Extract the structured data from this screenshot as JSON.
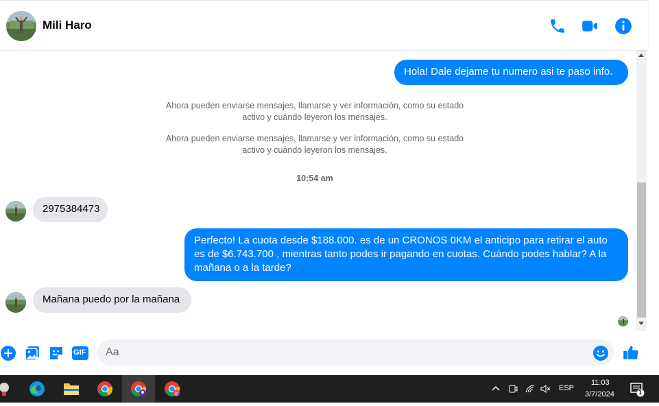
{
  "conversation": {
    "contact_name": "Mili Haro"
  },
  "messages": {
    "m1": "Hola! Dale dejame tu numero  asi te paso info.",
    "sys1_line1": "Ahora pueden enviarse mensajes, llamarse y ver información, como su estado",
    "sys1_line2": "activo y cuándo leyeron los mensajes.",
    "sys2_line1": "Ahora pueden enviarse mensajes, llamarse y ver información, como su estado",
    "sys2_line2": "activo y cuándo leyeron los mensajes.",
    "time": "10:54 am",
    "m2": "2975384473",
    "m3_line1": "Perfecto! La cuota desde $188.000. es de un CRONOS 0KM el anticipo para retirar el auto",
    "m3_line2": "es de $6.743.700 , mientras tanto podes ir pagando en cuotas. Cuándo podes hablar? A la",
    "m3_line3": "mañana o a la tarde?",
    "m4": "Mañana puedo por la mañana"
  },
  "composer": {
    "placeholder": "Aa",
    "gif_label": "GIF"
  },
  "taskbar": {
    "language": "ESP",
    "time": "11:03",
    "date": "3/7/2024",
    "notification_count": "1"
  },
  "colors": {
    "messenger_blue": "#0084ff",
    "incoming_bubble": "#e4e6eb",
    "taskbar": "#1f1f1f"
  }
}
